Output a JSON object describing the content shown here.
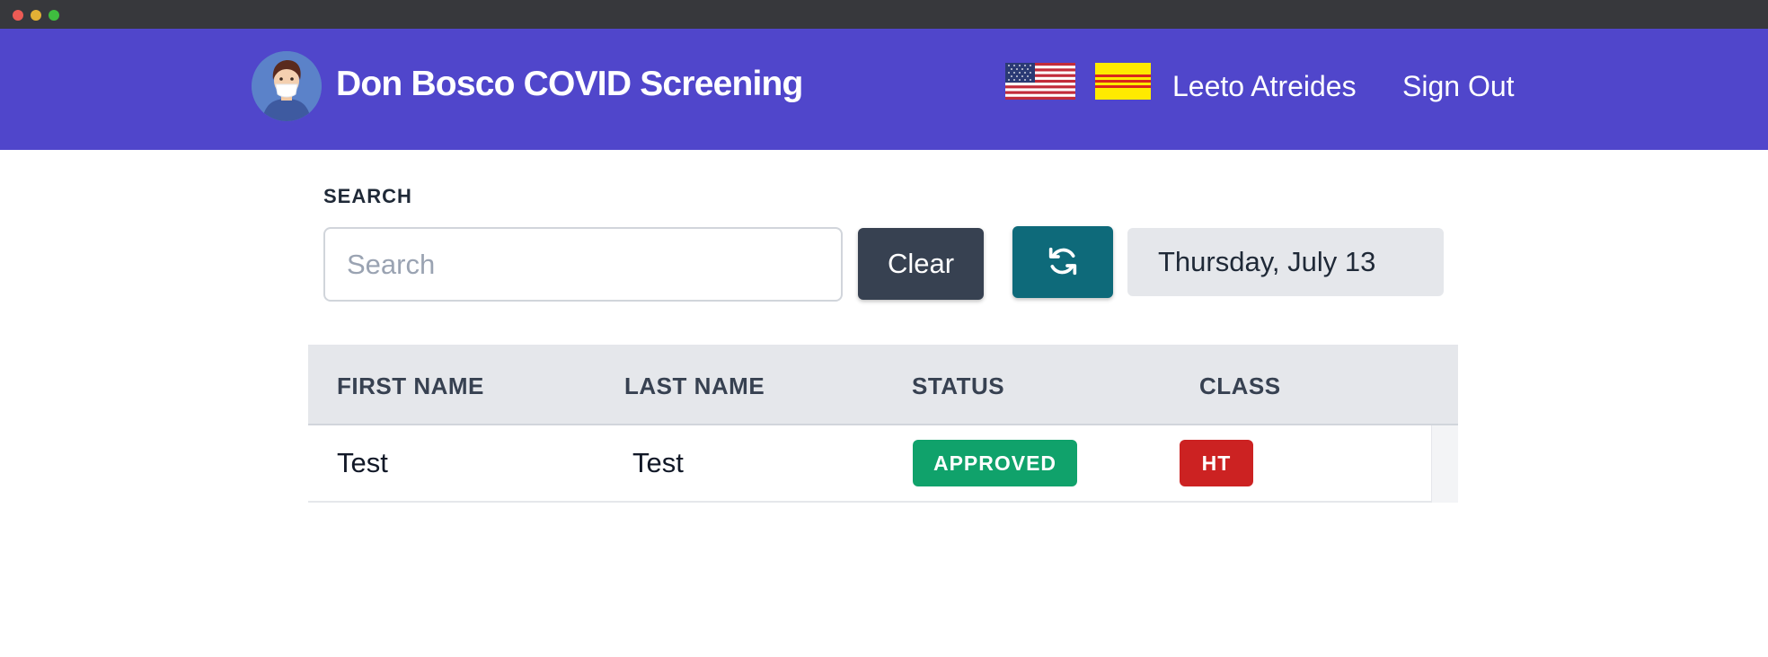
{
  "window": {
    "controls": [
      "close",
      "minimize",
      "maximize"
    ]
  },
  "navbar": {
    "brand_title": "Don Bosco COVID Screening",
    "avatar_icon": "masked-person-avatar",
    "flags": [
      {
        "name": "us-flag-icon",
        "language": "English"
      },
      {
        "name": "vn-flag-icon",
        "language": "Vietnamese"
      }
    ],
    "user_name": "Leeto Atreides",
    "sign_out_label": "Sign Out",
    "background_color": "#5046cb"
  },
  "search": {
    "label": "SEARCH",
    "placeholder": "Search",
    "value": "",
    "clear_label": "Clear",
    "refresh_icon": "refresh-icon",
    "date_display": "Thursday, July 13"
  },
  "table": {
    "columns": [
      "FIRST NAME",
      "LAST NAME",
      "STATUS",
      "CLASS"
    ],
    "rows": [
      {
        "first_name": "Test",
        "last_name": "Test",
        "status": "APPROVED",
        "class": "HT"
      }
    ]
  },
  "colors": {
    "clear_button": "#374151",
    "refresh_button": "#0e6a7a",
    "status_approved": "#10a26b",
    "class_badge": "#cc2222"
  }
}
